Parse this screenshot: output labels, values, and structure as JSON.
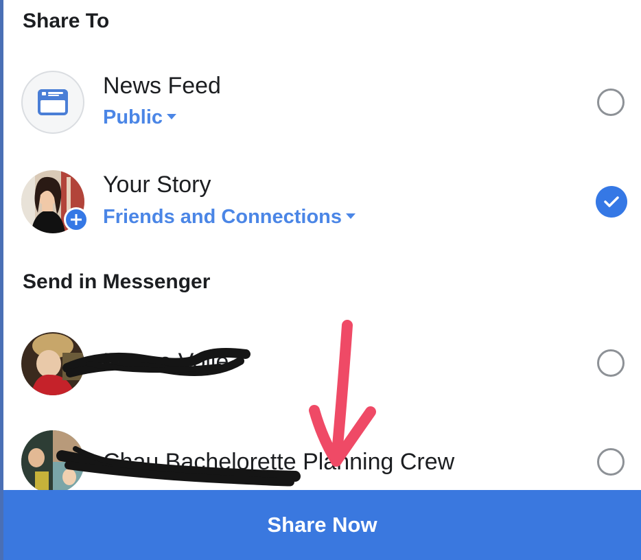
{
  "share_to": {
    "title": "Share To"
  },
  "news_feed": {
    "label": "News Feed",
    "audience": "Public",
    "icon": "news-feed-icon",
    "selected": false
  },
  "your_story": {
    "label": "Your Story",
    "audience": "Friends and Connections",
    "icon": "add-plus-icon",
    "selected": true
  },
  "messenger": {
    "title": "Send in Messenger",
    "contacts": [
      {
        "name": "Nanae Volle",
        "selected": false
      },
      {
        "name": "Chau Bachelorette Planning Crew",
        "selected": false
      }
    ]
  },
  "share_now": {
    "label": "Share Now"
  },
  "colors": {
    "accent_blue": "#3a78df",
    "link_blue": "#4b86e6",
    "annotation_arrow": "#ef4a66",
    "redaction": "#1a1a1a"
  }
}
